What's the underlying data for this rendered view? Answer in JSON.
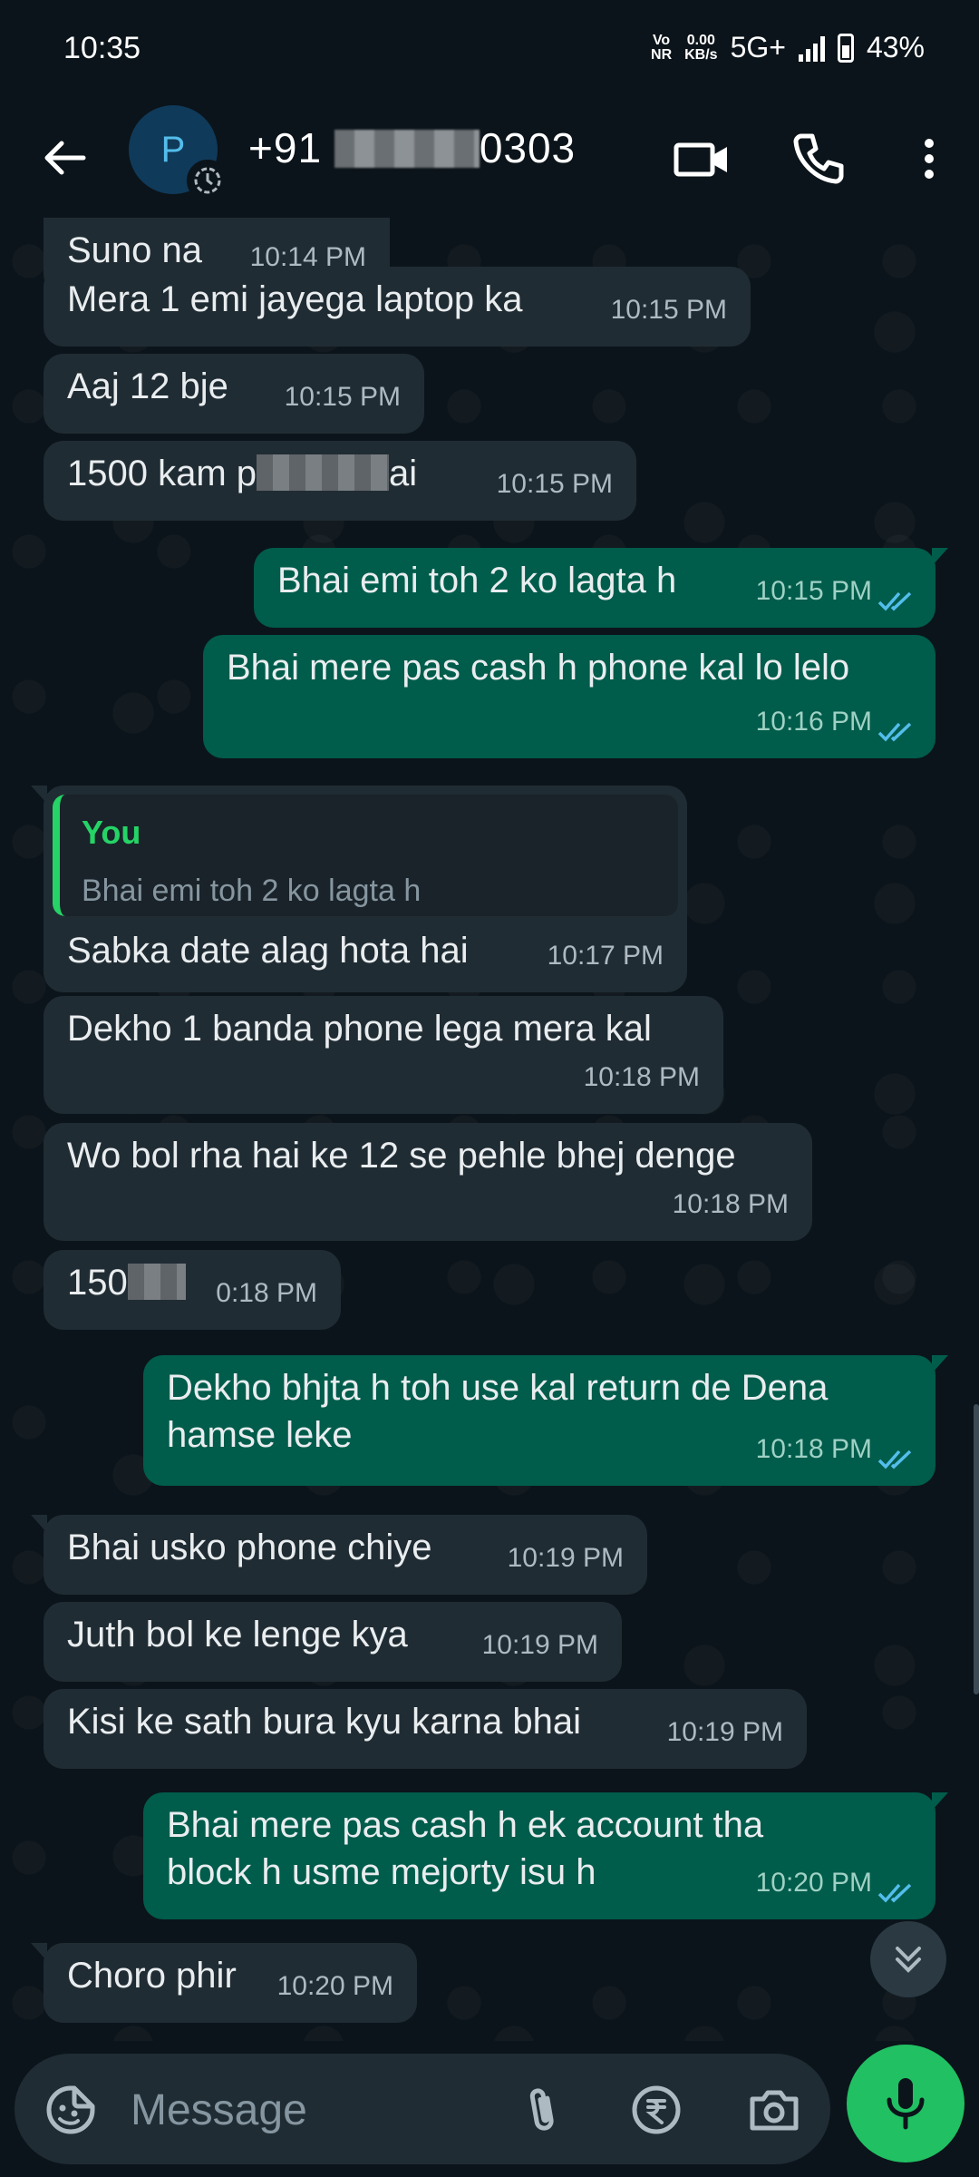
{
  "status_bar": {
    "time": "10:35",
    "network_small_1": "Vo\nNR",
    "speed_value": "0.00",
    "speed_unit": "KB/s",
    "network_type": "5G+",
    "battery_percent": "43%"
  },
  "header": {
    "avatar_initial": "P",
    "contact_prefix": "+91",
    "contact_suffix": "0303"
  },
  "messages": [
    {
      "dir": "in",
      "text": "Suno na",
      "time": "10:14 PM"
    },
    {
      "dir": "in",
      "text": "Mera 1 emi jayega laptop ka",
      "time": "10:15 PM"
    },
    {
      "dir": "in",
      "text": "Aaj 12 bje",
      "time": "10:15 PM"
    },
    {
      "dir": "in",
      "text_start": "1500 kam p",
      "text_end": "ai",
      "time": "10:15 PM"
    },
    {
      "dir": "out",
      "text": "Bhai emi toh 2 ko lagta h",
      "time": "10:15 PM"
    },
    {
      "dir": "out",
      "text": "Bhai mere pas cash h phone kal lo lelo",
      "time": "10:16 PM"
    },
    {
      "dir": "in",
      "reply_author": "You",
      "reply_text": "Bhai emi toh 2 ko lagta h",
      "text": "Sabka date alag hota hai",
      "time": "10:17 PM"
    },
    {
      "dir": "in",
      "text": "Dekho 1 banda phone lega mera kal",
      "time": "10:18 PM"
    },
    {
      "dir": "in",
      "text": "Wo bol rha hai ke 12 se pehle bhej denge",
      "time": "10:18 PM"
    },
    {
      "dir": "in",
      "text_start": "150",
      "time": "10:18 PM",
      "time_visible": "0:18 PM"
    },
    {
      "dir": "out",
      "text": "Dekho bhjta h toh use kal return de Dena hamse leke",
      "time": "10:18 PM"
    },
    {
      "dir": "in",
      "text": "Bhai usko phone chiye",
      "time": "10:19 PM"
    },
    {
      "dir": "in",
      "text": "Juth bol ke lenge kya",
      "time": "10:19 PM"
    },
    {
      "dir": "in",
      "text": "Kisi ke sath bura kyu karna bhai",
      "time": "10:19 PM"
    },
    {
      "dir": "out",
      "text": "Bhai mere pas cash h ek account tha block h usme mejorty  isu h",
      "time": "10:20 PM"
    },
    {
      "dir": "in",
      "text": "Choro phir",
      "time": "10:20 PM"
    }
  ],
  "composer": {
    "placeholder": "Message"
  },
  "colors": {
    "background": "#0b141a",
    "incoming_bubble": "#202c33",
    "outgoing_bubble": "#005c4b",
    "read_ticks": "#53bdeb",
    "mic_button": "#21c063"
  },
  "icons": [
    "back-arrow-icon",
    "status-timer-icon",
    "video-call-icon",
    "phone-icon",
    "more-vert-icon",
    "double-check-icon",
    "chevron-double-down-icon",
    "sticker-icon",
    "attach-icon",
    "rupee-icon",
    "camera-icon",
    "mic-icon"
  ]
}
